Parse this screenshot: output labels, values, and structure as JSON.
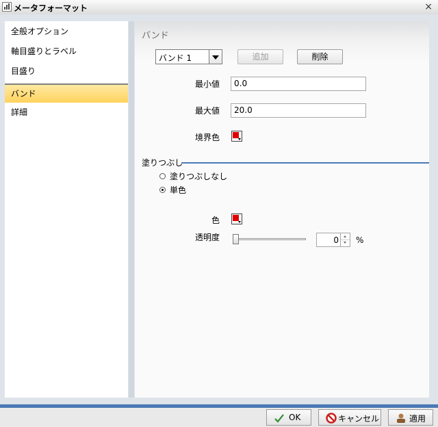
{
  "window": {
    "title": "メータフォーマット",
    "close_glyph": "×"
  },
  "sidebar": {
    "items": [
      {
        "label": "全般オプション",
        "selected": false
      },
      {
        "label": "軸目盛りとラベル",
        "selected": false
      },
      {
        "label": "目盛り",
        "selected": false
      },
      {
        "label": "バンド",
        "selected": true
      },
      {
        "label": "詳細",
        "selected": false
      }
    ]
  },
  "panel": {
    "header": "バンド",
    "band_select": {
      "value": "バンド 1"
    },
    "add_button": "追加",
    "delete_button": "削除",
    "min_label": "最小値",
    "min_value": "0.0",
    "max_label": "最大値",
    "max_value": "20.0",
    "border_color_label": "境界色",
    "border_color": "#e00000",
    "fill_section": "塗りつぶし",
    "fill_options": [
      {
        "label": "塗りつぶしなし",
        "checked": false
      },
      {
        "label": "単色",
        "checked": true
      }
    ],
    "color_label": "色",
    "color": "#e00000",
    "transparency_label": "透明度",
    "transparency_value": "0",
    "transparency_unit": "%"
  },
  "footer": {
    "ok_label": "OK",
    "cancel_label": "キャンセル",
    "apply_label": "適用"
  },
  "icons": {
    "ok": "check-icon",
    "cancel": "no-entry-icon",
    "apply": "user-stamp-icon"
  },
  "colors": {
    "accent": "#4a79b4",
    "selection": "#ffd35c",
    "swatch_red": "#e00000"
  }
}
